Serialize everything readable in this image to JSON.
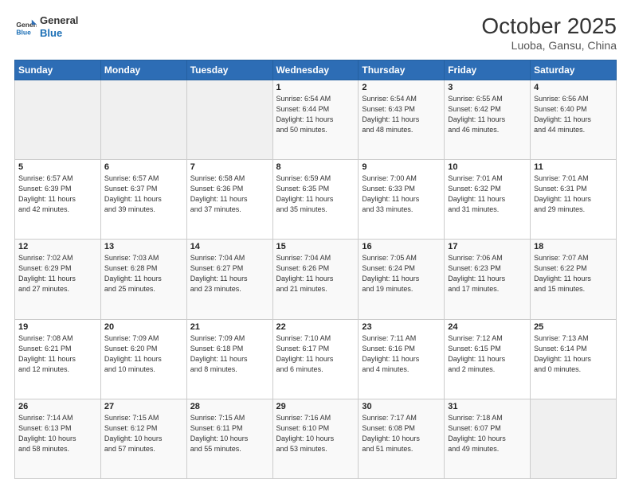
{
  "header": {
    "title": "October 2025",
    "subtitle": "Luoba, Gansu, China",
    "logo_line1": "General",
    "logo_line2": "Blue"
  },
  "weekdays": [
    "Sunday",
    "Monday",
    "Tuesday",
    "Wednesday",
    "Thursday",
    "Friday",
    "Saturday"
  ],
  "weeks": [
    [
      {
        "day": "",
        "info": ""
      },
      {
        "day": "",
        "info": ""
      },
      {
        "day": "",
        "info": ""
      },
      {
        "day": "1",
        "info": "Sunrise: 6:54 AM\nSunset: 6:44 PM\nDaylight: 11 hours\nand 50 minutes."
      },
      {
        "day": "2",
        "info": "Sunrise: 6:54 AM\nSunset: 6:43 PM\nDaylight: 11 hours\nand 48 minutes."
      },
      {
        "day": "3",
        "info": "Sunrise: 6:55 AM\nSunset: 6:42 PM\nDaylight: 11 hours\nand 46 minutes."
      },
      {
        "day": "4",
        "info": "Sunrise: 6:56 AM\nSunset: 6:40 PM\nDaylight: 11 hours\nand 44 minutes."
      }
    ],
    [
      {
        "day": "5",
        "info": "Sunrise: 6:57 AM\nSunset: 6:39 PM\nDaylight: 11 hours\nand 42 minutes."
      },
      {
        "day": "6",
        "info": "Sunrise: 6:57 AM\nSunset: 6:37 PM\nDaylight: 11 hours\nand 39 minutes."
      },
      {
        "day": "7",
        "info": "Sunrise: 6:58 AM\nSunset: 6:36 PM\nDaylight: 11 hours\nand 37 minutes."
      },
      {
        "day": "8",
        "info": "Sunrise: 6:59 AM\nSunset: 6:35 PM\nDaylight: 11 hours\nand 35 minutes."
      },
      {
        "day": "9",
        "info": "Sunrise: 7:00 AM\nSunset: 6:33 PM\nDaylight: 11 hours\nand 33 minutes."
      },
      {
        "day": "10",
        "info": "Sunrise: 7:01 AM\nSunset: 6:32 PM\nDaylight: 11 hours\nand 31 minutes."
      },
      {
        "day": "11",
        "info": "Sunrise: 7:01 AM\nSunset: 6:31 PM\nDaylight: 11 hours\nand 29 minutes."
      }
    ],
    [
      {
        "day": "12",
        "info": "Sunrise: 7:02 AM\nSunset: 6:29 PM\nDaylight: 11 hours\nand 27 minutes."
      },
      {
        "day": "13",
        "info": "Sunrise: 7:03 AM\nSunset: 6:28 PM\nDaylight: 11 hours\nand 25 minutes."
      },
      {
        "day": "14",
        "info": "Sunrise: 7:04 AM\nSunset: 6:27 PM\nDaylight: 11 hours\nand 23 minutes."
      },
      {
        "day": "15",
        "info": "Sunrise: 7:04 AM\nSunset: 6:26 PM\nDaylight: 11 hours\nand 21 minutes."
      },
      {
        "day": "16",
        "info": "Sunrise: 7:05 AM\nSunset: 6:24 PM\nDaylight: 11 hours\nand 19 minutes."
      },
      {
        "day": "17",
        "info": "Sunrise: 7:06 AM\nSunset: 6:23 PM\nDaylight: 11 hours\nand 17 minutes."
      },
      {
        "day": "18",
        "info": "Sunrise: 7:07 AM\nSunset: 6:22 PM\nDaylight: 11 hours\nand 15 minutes."
      }
    ],
    [
      {
        "day": "19",
        "info": "Sunrise: 7:08 AM\nSunset: 6:21 PM\nDaylight: 11 hours\nand 12 minutes."
      },
      {
        "day": "20",
        "info": "Sunrise: 7:09 AM\nSunset: 6:20 PM\nDaylight: 11 hours\nand 10 minutes."
      },
      {
        "day": "21",
        "info": "Sunrise: 7:09 AM\nSunset: 6:18 PM\nDaylight: 11 hours\nand 8 minutes."
      },
      {
        "day": "22",
        "info": "Sunrise: 7:10 AM\nSunset: 6:17 PM\nDaylight: 11 hours\nand 6 minutes."
      },
      {
        "day": "23",
        "info": "Sunrise: 7:11 AM\nSunset: 6:16 PM\nDaylight: 11 hours\nand 4 minutes."
      },
      {
        "day": "24",
        "info": "Sunrise: 7:12 AM\nSunset: 6:15 PM\nDaylight: 11 hours\nand 2 minutes."
      },
      {
        "day": "25",
        "info": "Sunrise: 7:13 AM\nSunset: 6:14 PM\nDaylight: 11 hours\nand 0 minutes."
      }
    ],
    [
      {
        "day": "26",
        "info": "Sunrise: 7:14 AM\nSunset: 6:13 PM\nDaylight: 10 hours\nand 58 minutes."
      },
      {
        "day": "27",
        "info": "Sunrise: 7:15 AM\nSunset: 6:12 PM\nDaylight: 10 hours\nand 57 minutes."
      },
      {
        "day": "28",
        "info": "Sunrise: 7:15 AM\nSunset: 6:11 PM\nDaylight: 10 hours\nand 55 minutes."
      },
      {
        "day": "29",
        "info": "Sunrise: 7:16 AM\nSunset: 6:10 PM\nDaylight: 10 hours\nand 53 minutes."
      },
      {
        "day": "30",
        "info": "Sunrise: 7:17 AM\nSunset: 6:08 PM\nDaylight: 10 hours\nand 51 minutes."
      },
      {
        "day": "31",
        "info": "Sunrise: 7:18 AM\nSunset: 6:07 PM\nDaylight: 10 hours\nand 49 minutes."
      },
      {
        "day": "",
        "info": ""
      }
    ]
  ]
}
